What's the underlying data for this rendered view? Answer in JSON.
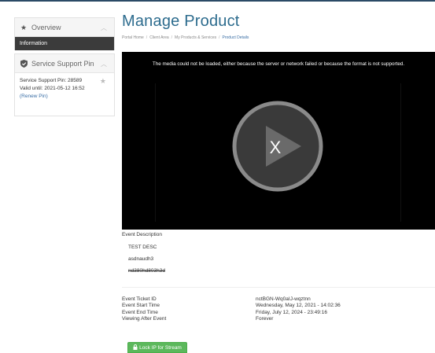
{
  "sidebar": {
    "overview": {
      "title": "Overview",
      "items": [
        {
          "label": "Information"
        }
      ]
    },
    "support_pin": {
      "title": "Service Support Pin",
      "pin_line": "Service Support Pin: 28589",
      "valid_line": "Valid until: 2021-05-12 16:52",
      "renew_label": "(Renew Pin)"
    }
  },
  "main": {
    "title": "Manage Product",
    "breadcrumb": [
      "Portal Home",
      "Client Area",
      "My Products & Services",
      "Product Details"
    ],
    "video": {
      "error_text": "The media could not be loaded, either because the server or network failed or because the format is not supported.",
      "overlay_glyph": "X"
    },
    "event_description_label": "Event Description",
    "description_lines": [
      "TEST DESC",
      "asdnaudh3",
      "nd380hd803h3d"
    ],
    "info_labels": [
      "Event Ticket ID",
      "Event Start Time",
      "Event End Time",
      "Viewing After Event"
    ],
    "info_values": [
      "nctBGN-Wq0aIJ-wqztnn",
      "Wednesday, May 12, 2021 - 14:02:36",
      "Friday, July 12, 2024 - 23:49:16",
      "Forever"
    ],
    "lock_button_label": "Lock IP for Stream"
  },
  "colors": {
    "title": "#2d6c8e",
    "active_item": "#3b3b3b",
    "lock_button": "#5cb85c",
    "link": "#3a6ea5"
  },
  "icons": {
    "overview": "star-icon",
    "support_pin": "shield-check-icon",
    "collapse": "chevron-up-icon",
    "favorite": "star-icon",
    "play": "play-icon",
    "lock": "lock-icon"
  }
}
